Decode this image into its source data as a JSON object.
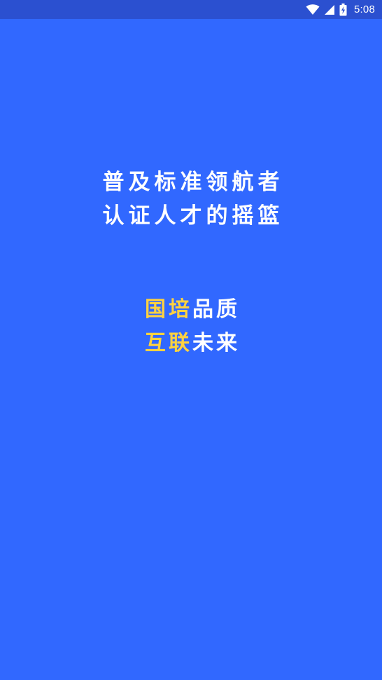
{
  "status_bar": {
    "time": "5:08",
    "icons": [
      "wifi-icon",
      "cellular-signal-icon",
      "battery-charging-icon"
    ]
  },
  "splash": {
    "primary_lines": [
      "普及标准领航者",
      "认证人才的摇篮"
    ],
    "secondary_lines": [
      {
        "accent": "国培",
        "plain": "品质"
      },
      {
        "accent": "互联",
        "plain": "未来"
      }
    ]
  },
  "colors": {
    "background": "#3168ff",
    "status_bar": "#2b50d0",
    "text": "#ffffff",
    "accent": "#ffd23f"
  }
}
